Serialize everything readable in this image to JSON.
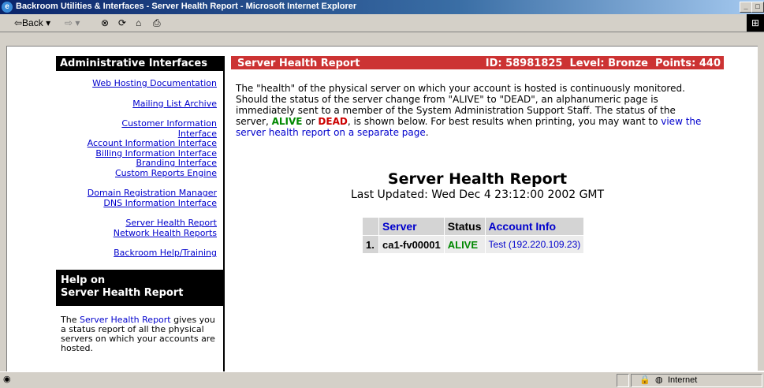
{
  "window": {
    "title": "Backroom Utilities & Interfaces - Server Health Report - Microsoft Internet Explorer"
  },
  "toolbar": {
    "back_label": "⇦Back",
    "back_drop": "▾",
    "forward_label": "⇨",
    "forward_drop": "▾"
  },
  "sidebar": {
    "heading": "Administrative Interfaces",
    "groups": [
      [
        "Web Hosting Documentation"
      ],
      [
        "Mailing List Archive"
      ],
      [
        "Customer Information Interface",
        "Account Information Interface",
        "Billing Information Interface",
        "Branding Interface",
        "Custom Reports Engine"
      ],
      [
        "Domain Registration Manager",
        "DNS Information Interface"
      ],
      [
        "Server Health Report",
        "Network Health Reports"
      ],
      [
        "Backroom Help/Training"
      ]
    ],
    "help_heading_line1": "Help on",
    "help_heading_line2": "Server Health Report",
    "help_link": "Server Health Report",
    "help_text_pre": "The ",
    "help_text_post": " gives you a status report of all the physical servers on which your accounts are hosted."
  },
  "header": {
    "title": "Server Health Report",
    "meta": "ID: 58981825  Level: Bronze  Points: 440"
  },
  "intro": {
    "part1": "The \"health\" of the physical server on which your account is hosted is continuously monitored. Should the status of the server change from \"ALIVE\" to \"DEAD\", an alphanumeric page is immediately sent to a member of the System Administration Support Staff. The status of the server, ",
    "alive": "ALIVE",
    "or": " or ",
    "dead": "DEAD",
    "part2": ", is shown below. For best results when printing, you may want to ",
    "link": "view the server health report on a separate page",
    "end": "."
  },
  "report": {
    "title": "Server Health Report",
    "updated": "Last Updated: Wed Dec 4 23:12:00 2002 GMT",
    "columns": [
      "Server",
      "Status",
      "Account Info"
    ],
    "rows": [
      {
        "num": "1.",
        "server": "ca1-fv00001",
        "status": "ALIVE",
        "account": "Test (192.220.109.23)"
      }
    ]
  },
  "statusbar": {
    "zone": "Internet"
  }
}
